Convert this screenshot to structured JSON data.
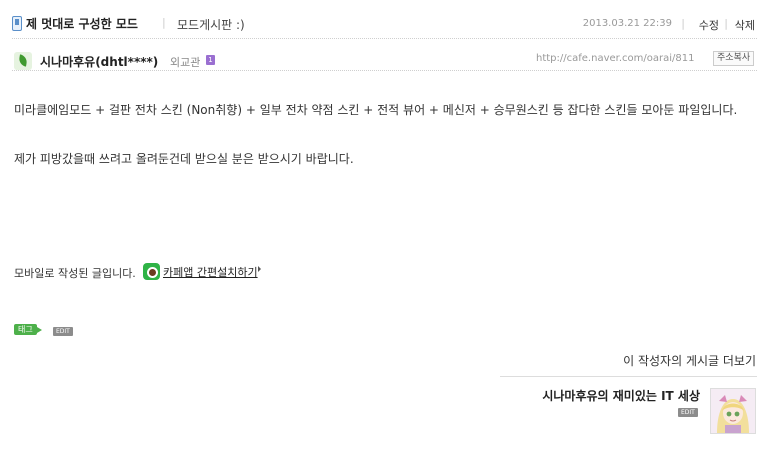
{
  "post": {
    "title": "제 멋대로 구성한 모드",
    "board": "모드게시판 :)",
    "date": "2013.03.21  22:39",
    "actions": {
      "edit": "수정",
      "delete": "삭제"
    },
    "separator": "|"
  },
  "author": {
    "nickname": "시나마후유(dhtl****)",
    "grade": "외교관",
    "grade_badge": "1",
    "icon": "leaf-icon"
  },
  "cafe": {
    "url": "http://cafe.naver.com/oarai/811",
    "copy_label": "주소복사"
  },
  "content": {
    "paragraph1": "미라클에임모드 + 걸판 전차 스킨 (Non취향) + 일부 전차 약점 스킨 + 전적 뷰어 + 메신저 + 승무원스킨 등 잡다한 스킨들 모아둔 파일입니다.",
    "paragraph2": "제가 피방갔을때 쓰려고 올려둔건데 받으실 분은 받으시기 바랍니다."
  },
  "mobile": {
    "note": "모바일로 작성된 글입니다.",
    "app_link": "카페앱 간편설치하기",
    "icon": "cafe-app-icon"
  },
  "tag": {
    "label": "태그",
    "edit": "EDIT"
  },
  "more": {
    "label": "이 작성자의 게시글 더보기"
  },
  "blog": {
    "title": "시나마후유의 재미있는 IT 세상",
    "edit": "EDIT"
  },
  "colors": {
    "accent_green": "#4db04a",
    "grade_purple": "#9a6fd1",
    "meta_gray": "#999999"
  }
}
